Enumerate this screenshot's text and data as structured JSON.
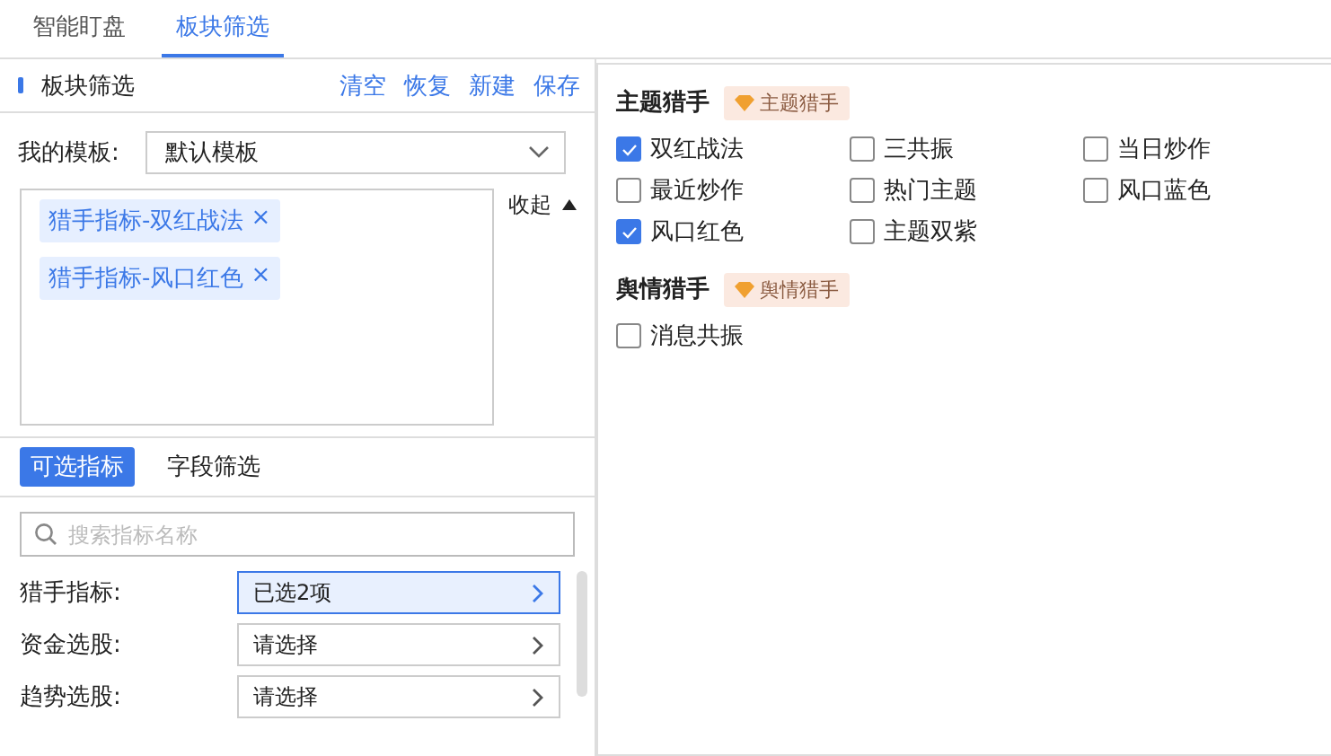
{
  "top_tabs": [
    {
      "label": "智能盯盘",
      "selected": false
    },
    {
      "label": "板块筛选",
      "selected": true
    }
  ],
  "left_panel": {
    "title": "板块筛选",
    "actions": [
      "清空",
      "恢复",
      "新建",
      "保存"
    ],
    "template": {
      "label": "我的模板:",
      "value": "默认模板"
    },
    "tags": [
      {
        "label": "猎手指标-双红战法",
        "remove": "×"
      },
      {
        "label": "猎手指标-风口红色",
        "remove": "×"
      }
    ],
    "collapse": "收起",
    "sub_tabs": [
      {
        "label": "可选指标",
        "selected": true
      },
      {
        "label": "字段筛选",
        "selected": false
      }
    ],
    "search": {
      "placeholder": "搜索指标名称"
    },
    "filters": [
      {
        "label": "猎手指标:",
        "value": "已选2项",
        "selected": true
      },
      {
        "label": "资金选股:",
        "value": "请选择",
        "selected": false
      },
      {
        "label": "趋势选股:",
        "value": "请选择",
        "selected": false
      }
    ]
  },
  "groups": [
    {
      "title": "主题猎手",
      "badge": "主题猎手",
      "options": [
        {
          "label": "双红战法",
          "checked": true
        },
        {
          "label": "三共振",
          "checked": false
        },
        {
          "label": "当日炒作",
          "checked": false
        },
        {
          "label": "最近炒作",
          "checked": false
        },
        {
          "label": "热门主题",
          "checked": false
        },
        {
          "label": "风口蓝色",
          "checked": false
        },
        {
          "label": "风口红色",
          "checked": true
        },
        {
          "label": "主题双紫",
          "checked": false
        }
      ]
    },
    {
      "title": "舆情猎手",
      "badge": "舆情猎手",
      "options": [
        {
          "label": "消息共振",
          "checked": false
        }
      ]
    }
  ]
}
